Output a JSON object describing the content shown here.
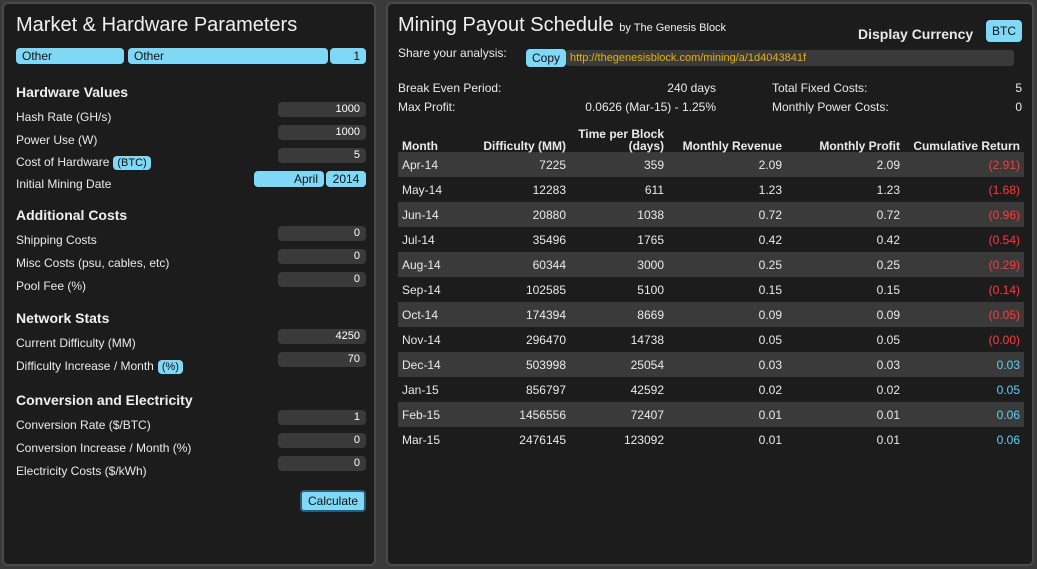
{
  "left": {
    "title": "Market & Hardware Parameters",
    "selectors": {
      "market": "Other",
      "hardware": "Other",
      "quantity": "1"
    },
    "hardware_values": {
      "heading": "Hardware Values",
      "hash_rate_label": "Hash Rate (GH/s)",
      "hash_rate": "1000",
      "power_label": "Power Use (W)",
      "power": "1000",
      "cost_label": "Cost of Hardware",
      "cost_unit": "(BTC)",
      "cost": "5",
      "date_label": "Initial Mining Date",
      "month": "April",
      "year": "2014"
    },
    "additional_costs": {
      "heading": "Additional Costs",
      "shipping_label": "Shipping Costs",
      "shipping": "0",
      "misc_label": "Misc Costs (psu, cables, etc)",
      "misc": "0",
      "pool_label": "Pool Fee (%)",
      "pool": "0"
    },
    "network": {
      "heading": "Network Stats",
      "difficulty_label": "Current Difficulty (MM)",
      "difficulty": "4250",
      "increase_label": "Difficulty Increase / Month",
      "increase_unit": "(%)",
      "increase": "70"
    },
    "conversion": {
      "heading": "Conversion and Electricity",
      "rate_label": "Conversion Rate ($/BTC)",
      "rate": "1",
      "rate_inc_label": "Conversion Increase / Month (%)",
      "rate_inc": "0",
      "elec_label": "Electricity Costs ($/kWh)",
      "elec": "0"
    },
    "calculate": "Calculate"
  },
  "right": {
    "title": "Mining Payout Schedule",
    "byline": "by The Genesis Block",
    "currency_label": "Display Currency",
    "currency": "BTC",
    "share_label": "Share your analysis:",
    "copy": "Copy",
    "url": "http://thegenesisblock.com/mining/a/1d4043841f",
    "break_even_label": "Break Even Period:",
    "break_even": "240 days",
    "max_profit_label": "Max Profit:",
    "max_profit": "0.0626 (Mar-15) - 1.25%",
    "fixed_costs_label": "Total Fixed Costs:",
    "fixed_costs": "5",
    "power_costs_label": "Monthly Power Costs:",
    "power_costs": "0",
    "headers": [
      "Month",
      "Difficulty (MM)",
      "Time per Block (days)",
      "Monthly Revenue",
      "Monthly Profit",
      "Cumulative Return"
    ],
    "rows": [
      {
        "month": "Apr-14",
        "difficulty": "7225",
        "time": "359",
        "revenue": "2.09",
        "profit": "2.09",
        "cumulative": "(2.91)",
        "sign": "neg"
      },
      {
        "month": "May-14",
        "difficulty": "12283",
        "time": "611",
        "revenue": "1.23",
        "profit": "1.23",
        "cumulative": "(1.68)",
        "sign": "neg"
      },
      {
        "month": "Jun-14",
        "difficulty": "20880",
        "time": "1038",
        "revenue": "0.72",
        "profit": "0.72",
        "cumulative": "(0.96)",
        "sign": "neg"
      },
      {
        "month": "Jul-14",
        "difficulty": "35496",
        "time": "1765",
        "revenue": "0.42",
        "profit": "0.42",
        "cumulative": "(0.54)",
        "sign": "neg"
      },
      {
        "month": "Aug-14",
        "difficulty": "60344",
        "time": "3000",
        "revenue": "0.25",
        "profit": "0.25",
        "cumulative": "(0.29)",
        "sign": "neg"
      },
      {
        "month": "Sep-14",
        "difficulty": "102585",
        "time": "5100",
        "revenue": "0.15",
        "profit": "0.15",
        "cumulative": "(0.14)",
        "sign": "neg"
      },
      {
        "month": "Oct-14",
        "difficulty": "174394",
        "time": "8669",
        "revenue": "0.09",
        "profit": "0.09",
        "cumulative": "(0.05)",
        "sign": "neg"
      },
      {
        "month": "Nov-14",
        "difficulty": "296470",
        "time": "14738",
        "revenue": "0.05",
        "profit": "0.05",
        "cumulative": "(0.00)",
        "sign": "neg"
      },
      {
        "month": "Dec-14",
        "difficulty": "503998",
        "time": "25054",
        "revenue": "0.03",
        "profit": "0.03",
        "cumulative": "0.03",
        "sign": "pos"
      },
      {
        "month": "Jan-15",
        "difficulty": "856797",
        "time": "42592",
        "revenue": "0.02",
        "profit": "0.02",
        "cumulative": "0.05",
        "sign": "pos"
      },
      {
        "month": "Feb-15",
        "difficulty": "1456556",
        "time": "72407",
        "revenue": "0.01",
        "profit": "0.01",
        "cumulative": "0.06",
        "sign": "pos"
      },
      {
        "month": "Mar-15",
        "difficulty": "2476145",
        "time": "123092",
        "revenue": "0.01",
        "profit": "0.01",
        "cumulative": "0.06",
        "sign": "pos"
      }
    ]
  }
}
